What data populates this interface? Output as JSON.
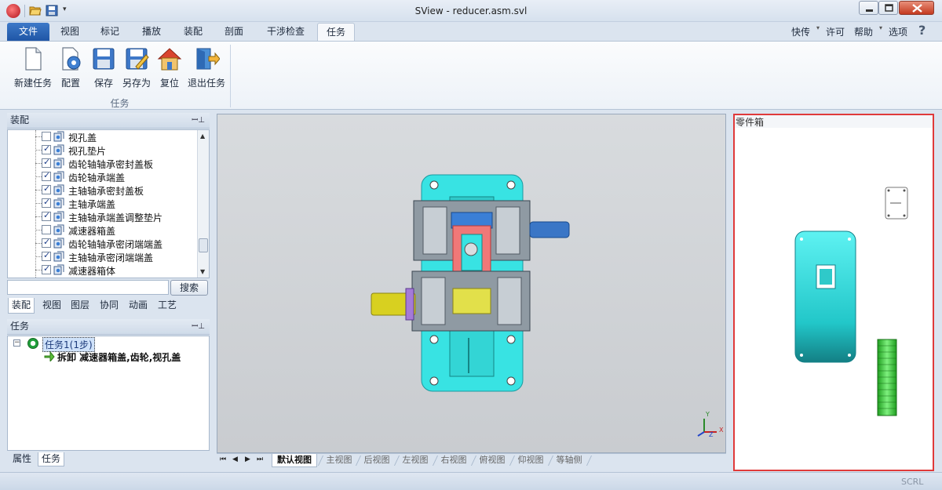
{
  "window": {
    "title": "SView - reducer.asm.svl"
  },
  "ribbon_tabs": [
    "文件",
    "视图",
    "标记",
    "播放",
    "装配",
    "剖面",
    "干涉检查",
    "任务"
  ],
  "ribbon_right": {
    "quick": "快传",
    "license": "许可",
    "help": "帮助",
    "options": "选项"
  },
  "ribbon": {
    "buttons": [
      "新建任务",
      "配置",
      "保存",
      "另存为",
      "复位",
      "退出任务"
    ],
    "group_label": "任务"
  },
  "assembly_panel": {
    "title": "装配",
    "items": [
      {
        "label": "视孔盖",
        "checked": false
      },
      {
        "label": "视孔垫片",
        "checked": true
      },
      {
        "label": "齿轮轴轴承密封盖板",
        "checked": true
      },
      {
        "label": "齿轮轴承端盖",
        "checked": true
      },
      {
        "label": "主轴轴承密封盖板",
        "checked": true
      },
      {
        "label": "主轴承端盖",
        "checked": true
      },
      {
        "label": "主轴轴承端盖调整垫片",
        "checked": true
      },
      {
        "label": "减速器箱盖",
        "checked": false
      },
      {
        "label": "齿轮轴轴承密闭端端盖",
        "checked": true
      },
      {
        "label": "主轴轴承密闭端端盖",
        "checked": true
      },
      {
        "label": "减速器箱体",
        "checked": true
      }
    ],
    "search_value": "",
    "search_button": "搜索",
    "tabs": [
      "装配",
      "视图",
      "图层",
      "协同",
      "动画",
      "工艺"
    ]
  },
  "task_panel": {
    "title": "任务",
    "root": "任务1(1步)",
    "step": "拆卸 减速器箱盖,齿轮,视孔盖",
    "bottom_tabs": [
      "属性",
      "任务"
    ]
  },
  "viewport": {
    "axis": {
      "x": "X",
      "y": "Y",
      "z": "Z"
    },
    "view_tabs": [
      "默认视图",
      "主视图",
      "后视图",
      "左视图",
      "右视图",
      "俯视图",
      "仰视图",
      "等轴侧"
    ]
  },
  "parts_bin": {
    "title": "零件箱"
  },
  "statusbar": {
    "scrl": "SCRL"
  },
  "icons": {
    "app": "sview-logo-icon",
    "open": "folder-open-icon",
    "save": "save-icon",
    "pin": "pin-icon",
    "help": "help-icon"
  },
  "colors": {
    "accent": "#1f56a6",
    "highlight_border": "#e03a3a",
    "housing": "#35e6e6",
    "gear": "#3ec63e",
    "shaft": "#d8d020"
  }
}
